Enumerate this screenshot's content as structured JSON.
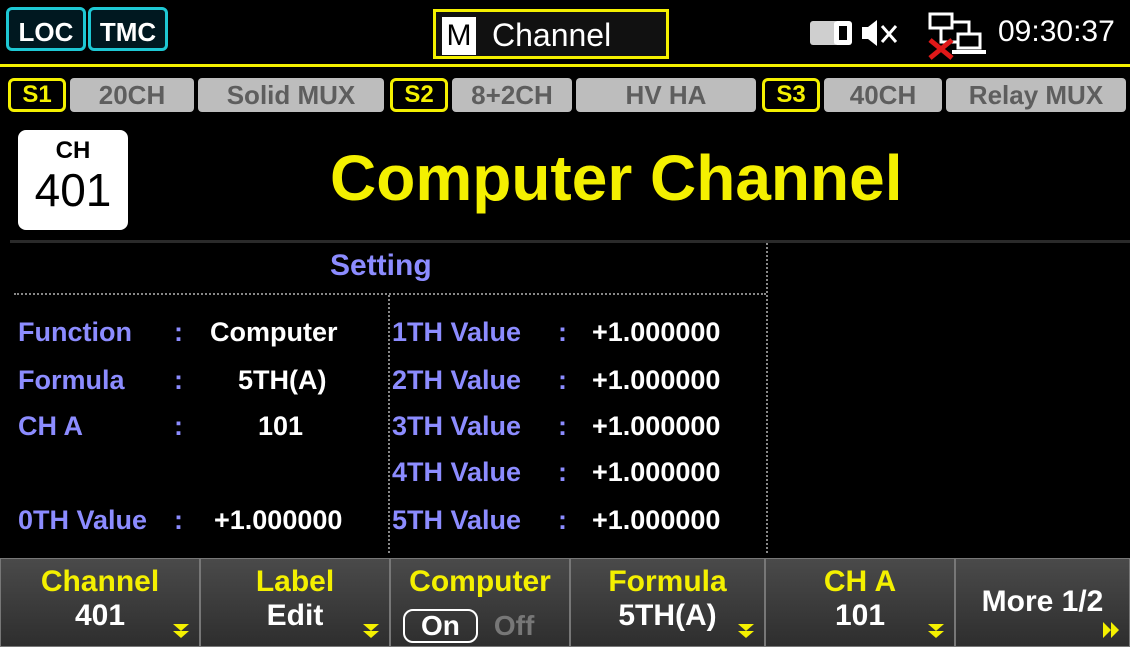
{
  "topbar": {
    "loc": "LOC",
    "tmc": "TMC",
    "mode_letter": "M",
    "mode_title": "Channel",
    "time": "09:30:37",
    "icons": [
      "drive-icon",
      "mute-icon",
      "network-disconnected-icon"
    ]
  },
  "slots": [
    {
      "id": "S1",
      "channels": "20CH",
      "type": "Solid MUX"
    },
    {
      "id": "S2",
      "channels": "8+2CH",
      "type": "HV  HA"
    },
    {
      "id": "S3",
      "channels": "40CH",
      "type": "Relay MUX"
    }
  ],
  "header": {
    "ch_label": "CH",
    "ch_number": "401",
    "title": "Computer Channel"
  },
  "setting": {
    "heading": "Setting",
    "left": [
      {
        "label": "Function",
        "colon": ":",
        "value": "Computer"
      },
      {
        "label": "Formula",
        "colon": ":",
        "value": "5TH(A)"
      },
      {
        "label": "CH A",
        "colon": ":",
        "value": "101"
      },
      {
        "label": "0TH Value",
        "colon": ":",
        "value": "+1.000000"
      }
    ],
    "right": [
      {
        "label": "1TH Value",
        "colon": ":",
        "value": "+1.000000"
      },
      {
        "label": "2TH Value",
        "colon": ":",
        "value": "+1.000000"
      },
      {
        "label": "3TH Value",
        "colon": ":",
        "value": "+1.000000"
      },
      {
        "label": "4TH Value",
        "colon": ":",
        "value": "+1.000000"
      },
      {
        "label": "5TH Value",
        "colon": ":",
        "value": "+1.000000"
      }
    ]
  },
  "softkeys": [
    {
      "top": "Channel",
      "bottom": "401"
    },
    {
      "top": "Label",
      "bottom": "Edit"
    },
    {
      "top": "Computer",
      "on": "On",
      "off": "Off"
    },
    {
      "top": "Formula",
      "bottom": "5TH(A)"
    },
    {
      "top": "CH A",
      "bottom": "101"
    },
    {
      "label": "More 1/2"
    }
  ],
  "colors": {
    "accent_yellow": "#f4f000",
    "label_blue": "#8c8cff",
    "tag_cyan": "#1ec8d4"
  }
}
